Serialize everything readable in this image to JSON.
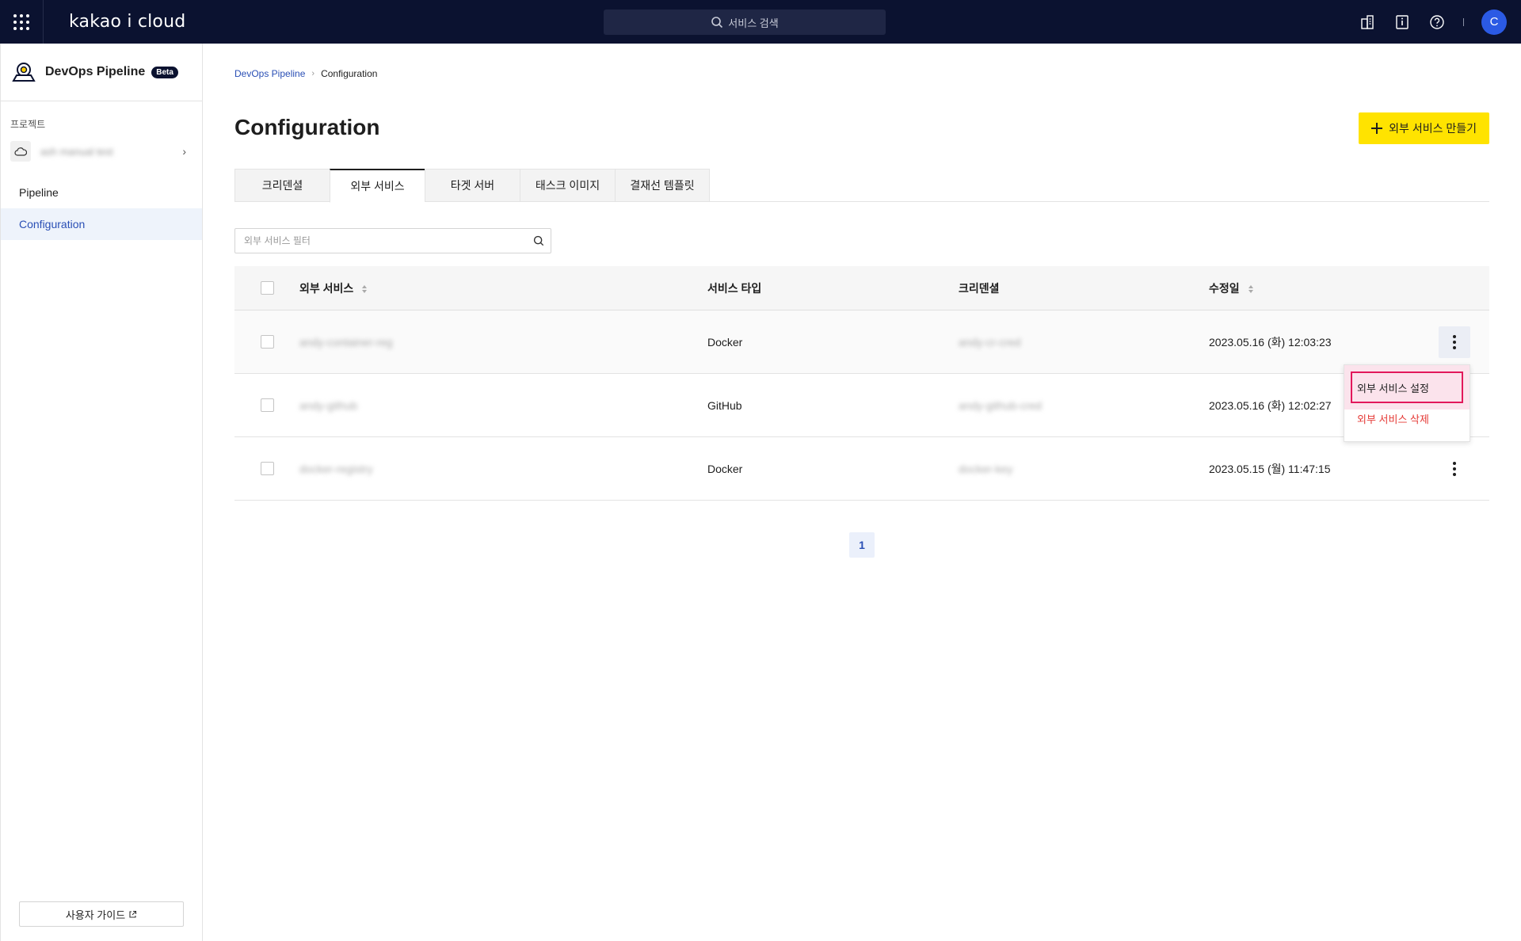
{
  "topbar": {
    "logo": "kakao i cloud",
    "search_placeholder": "서비스 검색",
    "avatar_initial": "C"
  },
  "sidebar": {
    "title": "DevOps Pipeline",
    "badge": "Beta",
    "section_label": "프로젝트",
    "project_name": "ash manual test",
    "items": [
      {
        "label": "Pipeline"
      },
      {
        "label": "Configuration"
      }
    ],
    "guide_label": "사용자 가이드"
  },
  "breadcrumb": {
    "root": "DevOps Pipeline",
    "current": "Configuration"
  },
  "page": {
    "title": "Configuration",
    "create_label": "외부 서비스 만들기"
  },
  "tabs": [
    {
      "label": "크리덴셜"
    },
    {
      "label": "외부 서비스"
    },
    {
      "label": "타겟 서버"
    },
    {
      "label": "태스크 이미지"
    },
    {
      "label": "결재선 템플릿"
    }
  ],
  "filter": {
    "placeholder": "외부 서비스 필터"
  },
  "table": {
    "headers": {
      "name": "외부 서비스",
      "type": "서비스 타입",
      "credential": "크리덴셜",
      "modified": "수정일"
    },
    "rows": [
      {
        "name": "andy-container-reg",
        "type": "Docker",
        "credential": "andy-cr-cred",
        "modified": "2023.05.16 (화) 12:03:23"
      },
      {
        "name": "andy-github",
        "type": "GitHub",
        "credential": "andy-github-cred",
        "modified": "2023.05.16 (화) 12:02:27"
      },
      {
        "name": "docker-registry",
        "type": "Docker",
        "credential": "docker-key",
        "modified": "2023.05.15 (월) 11:47:15"
      }
    ]
  },
  "dropdown": {
    "edit_label": "외부 서비스 설정",
    "delete_label": "외부 서비스 삭제"
  },
  "pagination": {
    "current": "1"
  },
  "colors": {
    "topbar": "#0b1230",
    "accent": "#2a4fb5",
    "create_button": "#ffe300",
    "danger": "#e53935",
    "highlight_border": "#e2185b"
  }
}
